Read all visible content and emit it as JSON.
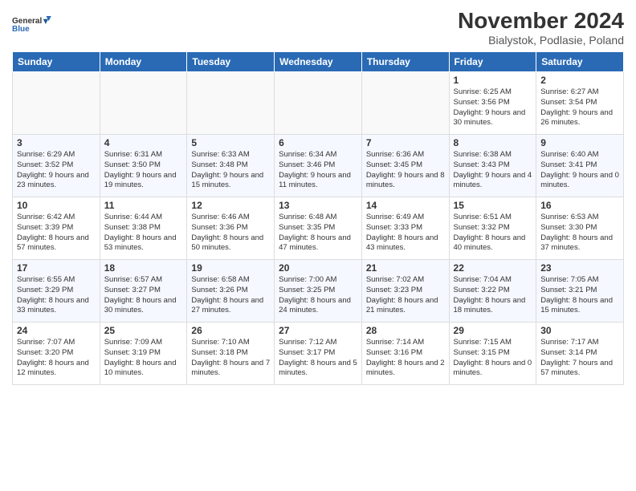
{
  "logo": {
    "line1": "General",
    "line2": "Blue"
  },
  "title": "November 2024",
  "subtitle": "Bialystok, Podlasie, Poland",
  "days_of_week": [
    "Sunday",
    "Monday",
    "Tuesday",
    "Wednesday",
    "Thursday",
    "Friday",
    "Saturday"
  ],
  "weeks": [
    [
      {
        "day": "",
        "details": ""
      },
      {
        "day": "",
        "details": ""
      },
      {
        "day": "",
        "details": ""
      },
      {
        "day": "",
        "details": ""
      },
      {
        "day": "",
        "details": ""
      },
      {
        "day": "1",
        "details": "Sunrise: 6:25 AM\nSunset: 3:56 PM\nDaylight: 9 hours and 30 minutes."
      },
      {
        "day": "2",
        "details": "Sunrise: 6:27 AM\nSunset: 3:54 PM\nDaylight: 9 hours and 26 minutes."
      }
    ],
    [
      {
        "day": "3",
        "details": "Sunrise: 6:29 AM\nSunset: 3:52 PM\nDaylight: 9 hours and 23 minutes."
      },
      {
        "day": "4",
        "details": "Sunrise: 6:31 AM\nSunset: 3:50 PM\nDaylight: 9 hours and 19 minutes."
      },
      {
        "day": "5",
        "details": "Sunrise: 6:33 AM\nSunset: 3:48 PM\nDaylight: 9 hours and 15 minutes."
      },
      {
        "day": "6",
        "details": "Sunrise: 6:34 AM\nSunset: 3:46 PM\nDaylight: 9 hours and 11 minutes."
      },
      {
        "day": "7",
        "details": "Sunrise: 6:36 AM\nSunset: 3:45 PM\nDaylight: 9 hours and 8 minutes."
      },
      {
        "day": "8",
        "details": "Sunrise: 6:38 AM\nSunset: 3:43 PM\nDaylight: 9 hours and 4 minutes."
      },
      {
        "day": "9",
        "details": "Sunrise: 6:40 AM\nSunset: 3:41 PM\nDaylight: 9 hours and 0 minutes."
      }
    ],
    [
      {
        "day": "10",
        "details": "Sunrise: 6:42 AM\nSunset: 3:39 PM\nDaylight: 8 hours and 57 minutes."
      },
      {
        "day": "11",
        "details": "Sunrise: 6:44 AM\nSunset: 3:38 PM\nDaylight: 8 hours and 53 minutes."
      },
      {
        "day": "12",
        "details": "Sunrise: 6:46 AM\nSunset: 3:36 PM\nDaylight: 8 hours and 50 minutes."
      },
      {
        "day": "13",
        "details": "Sunrise: 6:48 AM\nSunset: 3:35 PM\nDaylight: 8 hours and 47 minutes."
      },
      {
        "day": "14",
        "details": "Sunrise: 6:49 AM\nSunset: 3:33 PM\nDaylight: 8 hours and 43 minutes."
      },
      {
        "day": "15",
        "details": "Sunrise: 6:51 AM\nSunset: 3:32 PM\nDaylight: 8 hours and 40 minutes."
      },
      {
        "day": "16",
        "details": "Sunrise: 6:53 AM\nSunset: 3:30 PM\nDaylight: 8 hours and 37 minutes."
      }
    ],
    [
      {
        "day": "17",
        "details": "Sunrise: 6:55 AM\nSunset: 3:29 PM\nDaylight: 8 hours and 33 minutes."
      },
      {
        "day": "18",
        "details": "Sunrise: 6:57 AM\nSunset: 3:27 PM\nDaylight: 8 hours and 30 minutes."
      },
      {
        "day": "19",
        "details": "Sunrise: 6:58 AM\nSunset: 3:26 PM\nDaylight: 8 hours and 27 minutes."
      },
      {
        "day": "20",
        "details": "Sunrise: 7:00 AM\nSunset: 3:25 PM\nDaylight: 8 hours and 24 minutes."
      },
      {
        "day": "21",
        "details": "Sunrise: 7:02 AM\nSunset: 3:23 PM\nDaylight: 8 hours and 21 minutes."
      },
      {
        "day": "22",
        "details": "Sunrise: 7:04 AM\nSunset: 3:22 PM\nDaylight: 8 hours and 18 minutes."
      },
      {
        "day": "23",
        "details": "Sunrise: 7:05 AM\nSunset: 3:21 PM\nDaylight: 8 hours and 15 minutes."
      }
    ],
    [
      {
        "day": "24",
        "details": "Sunrise: 7:07 AM\nSunset: 3:20 PM\nDaylight: 8 hours and 12 minutes."
      },
      {
        "day": "25",
        "details": "Sunrise: 7:09 AM\nSunset: 3:19 PM\nDaylight: 8 hours and 10 minutes."
      },
      {
        "day": "26",
        "details": "Sunrise: 7:10 AM\nSunset: 3:18 PM\nDaylight: 8 hours and 7 minutes."
      },
      {
        "day": "27",
        "details": "Sunrise: 7:12 AM\nSunset: 3:17 PM\nDaylight: 8 hours and 5 minutes."
      },
      {
        "day": "28",
        "details": "Sunrise: 7:14 AM\nSunset: 3:16 PM\nDaylight: 8 hours and 2 minutes."
      },
      {
        "day": "29",
        "details": "Sunrise: 7:15 AM\nSunset: 3:15 PM\nDaylight: 8 hours and 0 minutes."
      },
      {
        "day": "30",
        "details": "Sunrise: 7:17 AM\nSunset: 3:14 PM\nDaylight: 7 hours and 57 minutes."
      }
    ]
  ]
}
